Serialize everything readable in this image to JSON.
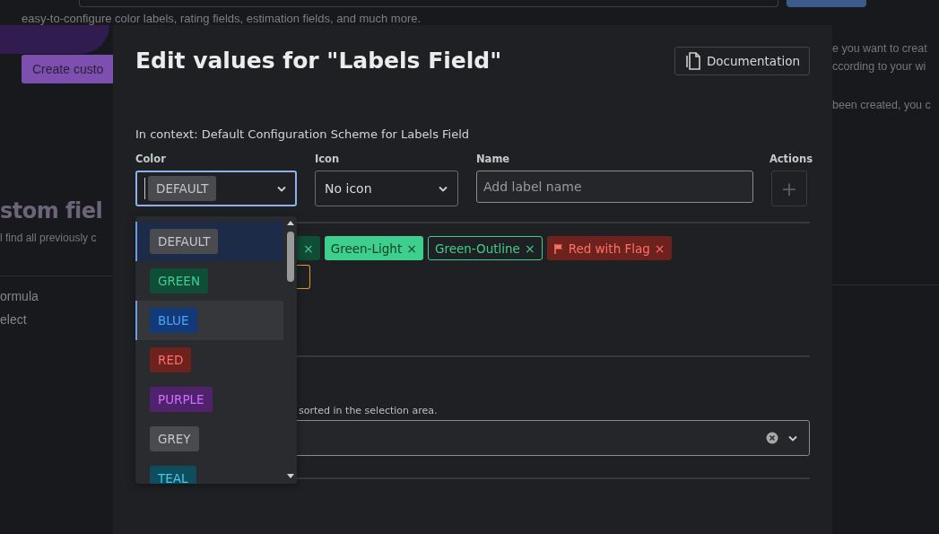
{
  "background_page": {
    "intro_text": "easy-to-configure color labels, rating fields, estimation fields, and much more.",
    "create_button": "Create custo",
    "heading": "stom fiel",
    "description": "l find all previously c",
    "field_types": [
      "ormula",
      "elect"
    ],
    "side_texts": [
      "e you want to creat",
      "ccording to your wi",
      "been created, you c"
    ]
  },
  "dialog": {
    "title": "Edit values for \"Labels Field\"",
    "documentation_button": "Documentation",
    "context": "In context: Default Configuration Scheme for Labels Field",
    "column_labels": [
      "Color",
      "Icon",
      "Name",
      "Actions"
    ],
    "color_select": {
      "value": "DEFAULT",
      "color": "#4a4b4f",
      "focused": true
    },
    "icon_select": {
      "value": "No icon"
    },
    "name_field": {
      "placeholder": "Add label name"
    },
    "add_button": {
      "label": "+",
      "disabled": true
    },
    "label_rows": [
      [
        {
          "kind": "solid",
          "color": "#0e4d36",
          "remove": "×",
          "flag": false
        },
        {
          "kind": "solid",
          "color": "#3ecf8e",
          "label": "Green-Light",
          "remove": "×",
          "flag": false
        },
        {
          "kind": "outline",
          "color": "#3ecf8e",
          "label": "Green-Outline",
          "remove": "×",
          "flag": false
        },
        {
          "kind": "solid",
          "color": "#6e221e",
          "label": "Red with Flag",
          "remove": "×",
          "flag": true
        }
      ],
      [
        {
          "kind": "outline",
          "color": "#d9a020",
          "flag": false
        }
      ]
    ],
    "sort_help": "sorted in the selection area.",
    "sort_select": {
      "clearable": true
    }
  },
  "color_menu": [
    {
      "label": "DEFAULT",
      "color": "#4a4b4f",
      "selected": true,
      "highlighted": false
    },
    {
      "label": "GREEN",
      "color": "#0e4d36",
      "selected": false,
      "highlighted": false
    },
    {
      "label": "BLUE",
      "color": "#123a7a",
      "selected": false,
      "highlighted": true
    },
    {
      "label": "RED",
      "color": "#6e221e",
      "selected": false,
      "highlighted": false
    },
    {
      "label": "PURPLE",
      "color": "#50226e",
      "selected": false,
      "highlighted": false
    },
    {
      "label": "GREY",
      "color": "#4a4b4f",
      "selected": false,
      "highlighted": false
    },
    {
      "label": "TEAL",
      "color": "#0e4d5e",
      "selected": false,
      "highlighted": false
    }
  ]
}
